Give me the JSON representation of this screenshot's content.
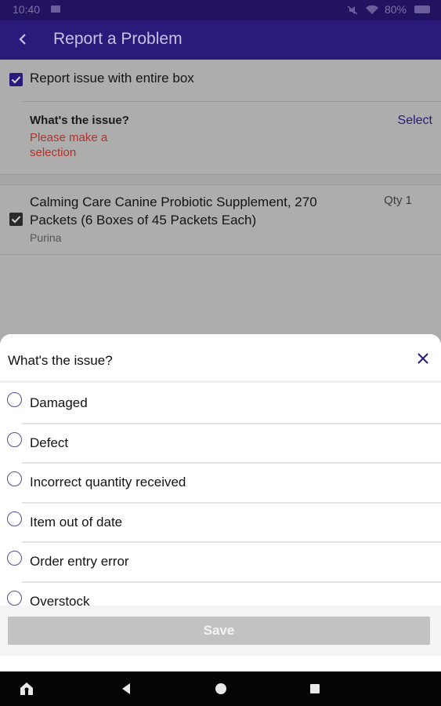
{
  "status_bar": {
    "time": "10:40",
    "battery": "80%"
  },
  "app_bar": {
    "title": "Report a Problem"
  },
  "report_entire": {
    "label": "Report issue with entire box",
    "checked": true
  },
  "issue_field": {
    "question": "What's the issue?",
    "error": "Please make a selection",
    "select_label": "Select"
  },
  "product": {
    "name": "Calming Care Canine Probiotic Supplement, 270 Packets (6 Boxes of 45 Packets Each)",
    "brand": "Purina",
    "qty": "Qty 1",
    "checked": true
  },
  "sheet": {
    "title": "What's the issue?",
    "options": [
      {
        "label": "Damaged"
      },
      {
        "label": "Defect"
      },
      {
        "label": "Incorrect quantity received"
      },
      {
        "label": "Item out of date"
      },
      {
        "label": "Order entry error"
      },
      {
        "label": "Overstock"
      }
    ],
    "save_label": "Save"
  },
  "colors": {
    "primary": "#2c1a7a",
    "error": "#b0322a",
    "disabled": "#c2c2c2"
  },
  "icons": {
    "back": "arrow-left-icon",
    "close": "close-icon",
    "checkbox": "checkbox-checked-icon",
    "radio": "radio-unchecked-icon",
    "nav_home": "home-icon",
    "nav_back": "triangle-back-icon",
    "nav_circle": "circle-home-icon",
    "nav_square": "square-recents-icon"
  }
}
